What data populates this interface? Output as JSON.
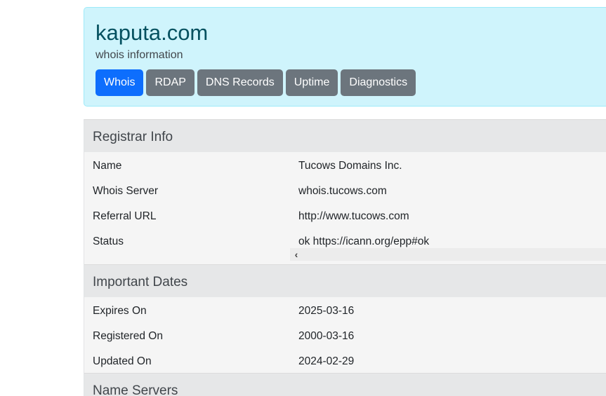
{
  "header": {
    "domain": "kaputa.com",
    "subtitle": "whois information",
    "tabs": [
      {
        "label": "Whois",
        "active": true
      },
      {
        "label": "RDAP",
        "active": false
      },
      {
        "label": "DNS Records",
        "active": false
      },
      {
        "label": "Uptime",
        "active": false
      },
      {
        "label": "Diagnostics",
        "active": false
      }
    ]
  },
  "registrar_info": {
    "title": "Registrar Info",
    "rows": [
      {
        "label": "Name",
        "value": "Tucows Domains Inc."
      },
      {
        "label": "Whois Server",
        "value": "whois.tucows.com"
      },
      {
        "label": "Referral URL",
        "value": "http://www.tucows.com"
      },
      {
        "label": "Status",
        "value": "ok https://icann.org/epp#ok"
      }
    ],
    "scroll_left_glyph": "‹"
  },
  "important_dates": {
    "title": "Important Dates",
    "rows": [
      {
        "label": "Expires On",
        "value": "2025-03-16"
      },
      {
        "label": "Registered On",
        "value": "2000-03-16"
      },
      {
        "label": "Updated On",
        "value": "2024-02-29"
      }
    ]
  },
  "name_servers": {
    "title": "Name Servers"
  },
  "colors": {
    "header_bg": "#cff4fc",
    "domain_text": "#055160",
    "active_tab": "#0d6efd",
    "inactive_tab": "#6c757d",
    "section_bg": "#e6e7e8",
    "row_bg": "#f5f5f5"
  }
}
